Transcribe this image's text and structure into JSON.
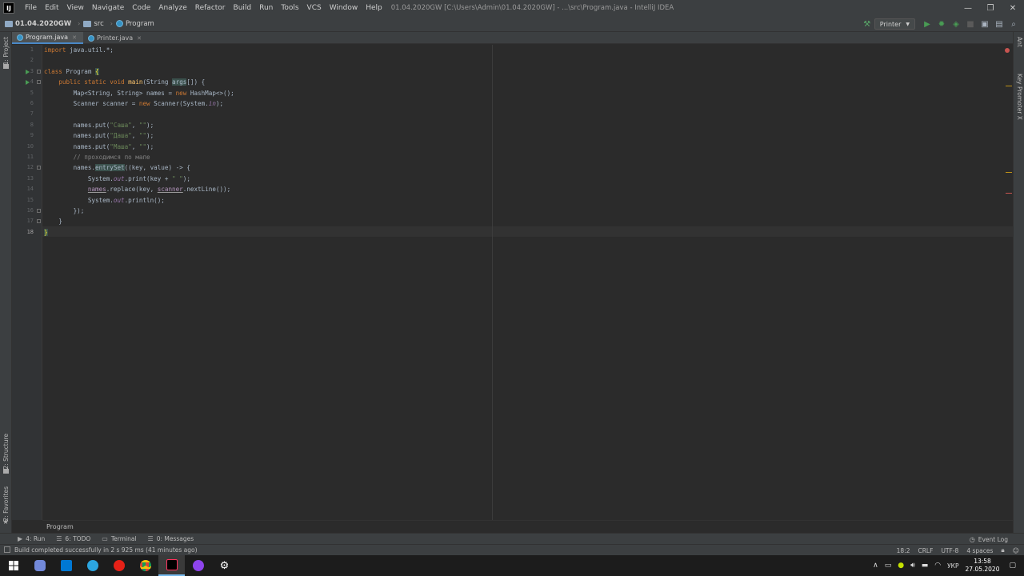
{
  "titlebar": {
    "logo": "IJ",
    "menu": [
      "File",
      "Edit",
      "View",
      "Navigate",
      "Code",
      "Analyze",
      "Refactor",
      "Build",
      "Run",
      "Tools",
      "VCS",
      "Window",
      "Help"
    ],
    "title": "01.04.2020GW [C:\\Users\\Admin\\01.04.2020GW] - ...\\src\\Program.java - IntelliJ IDEA",
    "controls": {
      "minimize": "—",
      "restore": "❐",
      "close": "✕"
    }
  },
  "navbar": {
    "project": "01.04.2020GW",
    "folder": "src",
    "file": "Program",
    "run_config": "Printer",
    "icons": [
      "hammer-icon",
      "run-icon",
      "debug-icon",
      "coverage-icon",
      "stop-icon",
      "project-structure-icon",
      "layout-icon"
    ]
  },
  "left_stripe": {
    "project": "1: Project",
    "structure": "2: Structure",
    "favorites": "2: Favorites"
  },
  "right_stripe": {
    "ant": "Ant",
    "key_promoter": "Key Promoter X"
  },
  "tabs": [
    {
      "label": "Program.java",
      "active": true
    },
    {
      "label": "Printer.java",
      "active": false
    }
  ],
  "editor": {
    "line_numbers": [
      "1",
      "2",
      "3",
      "4",
      "5",
      "6",
      "7",
      "8",
      "9",
      "10",
      "11",
      "12",
      "13",
      "14",
      "15",
      "16",
      "17",
      "18"
    ]
  },
  "editor_crumb": "Program",
  "bottom_tools": [
    {
      "icon": "▶",
      "label": "4: Run"
    },
    {
      "icon": "☰",
      "label": "6: TODO"
    },
    {
      "icon": "▭",
      "label": "Terminal"
    },
    {
      "icon": "☰",
      "label": "0: Messages"
    }
  ],
  "event_log": "Event Log",
  "status": {
    "message": "Build completed successfully in 2 s 925 ms (41 minutes ago)",
    "position": "18:2",
    "line_sep": "CRLF",
    "encoding": "UTF-8",
    "indent": "4 spaces"
  },
  "taskbar": {
    "lang": "УКР",
    "time": "13:58",
    "date": "27.05.2020"
  },
  "colors": {
    "accent": "#4a88c7",
    "keyword": "#cc7832",
    "string": "#6a8759",
    "run_green": "#499c54"
  }
}
